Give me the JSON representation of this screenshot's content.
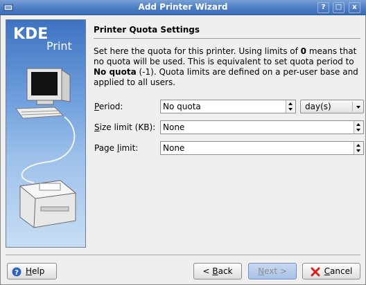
{
  "window": {
    "title": "Add Printer Wizard"
  },
  "titlebar_buttons": {
    "help": "?",
    "maximize": "□",
    "close": "x"
  },
  "side_panel": {
    "brand_kde": "KDE",
    "brand_print": "Print"
  },
  "page": {
    "heading": "Printer Quota Settings",
    "description_parts": {
      "p1": "Set here the quota for this printer. Using limits of ",
      "b1": "0",
      "p2": " means that no quota will be used. This is equivalent to set quota period to ",
      "b2": "No quota",
      "p3": " (-1). Quota limits are defined on a per-user base and applied to all users."
    }
  },
  "form": {
    "period": {
      "label_access": "P",
      "label_rest": "eriod:",
      "value": "No quota"
    },
    "period_unit": {
      "value": "day(s)"
    },
    "size_limit": {
      "label_access": "S",
      "label_rest": "ize limit (KB):",
      "value": "None"
    },
    "page_limit": {
      "label_pre": "Page ",
      "label_access": "l",
      "label_rest": "imit:",
      "value": "None"
    }
  },
  "buttons": {
    "help": {
      "access": "H",
      "rest": "elp"
    },
    "back": {
      "pre": "< ",
      "access": "B",
      "rest": "ack"
    },
    "next": {
      "access": "N",
      "rest": "ext >"
    },
    "cancel": {
      "access": "C",
      "rest": "ancel"
    }
  },
  "colors": {
    "titlebar": "#4f7fc4",
    "next_button": "#a9c1e8",
    "cancel_icon": "#d42020",
    "help_icon": "#2f63b8"
  }
}
